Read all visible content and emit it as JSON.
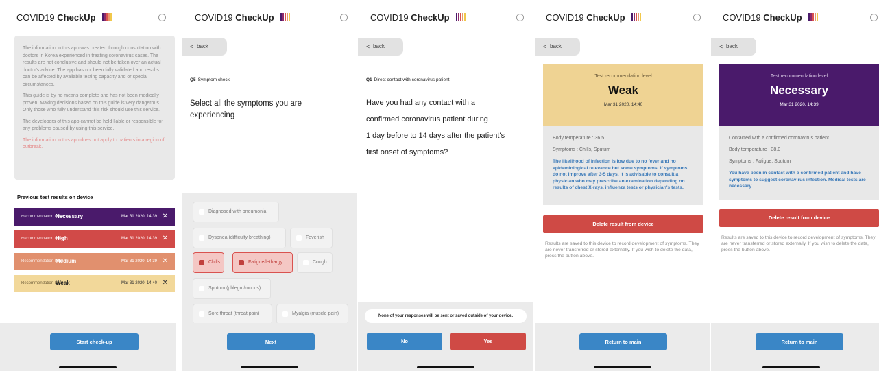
{
  "app": {
    "title_prefix": "COVID19",
    "title_bold": "CheckUp",
    "info_glyph": "i",
    "logo_colors": [
      "#4a1a6b",
      "#8e2a6a",
      "#d9524f",
      "#e89a6a",
      "#f1c84b"
    ],
    "back_label": "back",
    "back_glyph": "<"
  },
  "screen1": {
    "disclaimer": [
      "The information in this app was created through consultation with doctors in Korea experienced in treating coronavirus cases. The results are not conclusive and should not be taken over an actual doctor's advice. The app has not been fully validated and results can be affected by available testing capacity and or special circumstances.",
      "This guide is by no means complete and has not been medically proven. Making decisions based on this guide is very dangerous. Only those who fully understand this risk should use this service.",
      "The developers of this app cannot be held liable or responsible for any problems caused by using this service."
    ],
    "disclaimer_warning": "The information in this app does not apply to patients in a region of outbreak.",
    "prev_title": "Previous test results on device",
    "results": [
      {
        "label": "Recommendation level",
        "level": "Necessary",
        "date": "Mar 31 2020, 14:39",
        "color": "#4a1a6b",
        "close": "✕"
      },
      {
        "label": "Recommendation level",
        "level": "High",
        "date": "Mar 31 2020, 14:39",
        "color": "#d14a48",
        "close": "✕"
      },
      {
        "label": "Recommendation level",
        "level": "Medium",
        "date": "Mar 31 2020, 14:39",
        "color": "#e1906e",
        "close": "✕"
      },
      {
        "label": "Recommendation level",
        "level": "Weak",
        "date": "Mar 31 2020, 14:40",
        "color": "#f2d89a",
        "close": "✕"
      }
    ],
    "start_button": "Start check-up"
  },
  "screen2": {
    "q_num": "Q5",
    "q_title": "Symptom check",
    "question": "Select all the symptoms you are experiencing",
    "symptoms": [
      {
        "label": "Diagnosed with pneumonia",
        "selected": false
      },
      {
        "label": "Dyspnea (difficulty breathing)",
        "selected": false
      },
      {
        "label": "Feverish",
        "selected": false
      },
      {
        "label": "Chills",
        "selected": true
      },
      {
        "label": "Fatigue/lethargy",
        "selected": true
      },
      {
        "label": "Cough",
        "selected": false
      },
      {
        "label": "Sputum (phlegm/mucus)",
        "selected": false
      },
      {
        "label": "Sore throat (throat pain)",
        "selected": false
      },
      {
        "label": "Myalgia (muscle pain)",
        "selected": false
      }
    ],
    "next_button": "Next"
  },
  "screen3": {
    "q_num": "Q1",
    "q_title": "Direct contact with coronavirus patient",
    "question_lines": [
      "Have you had any contact with a",
      "confirmed coronavirus patient during",
      "1 day before to 14 days after the patient's",
      "first onset of symptoms?"
    ],
    "notice": "None of your responses will be sent or saved outside of your device.",
    "no_button": "No",
    "yes_button": "Yes"
  },
  "screen4": {
    "card_label": "Test recommendation level",
    "level": "Weak",
    "date": "Mar 31 2020, 14:40",
    "card_color": "#efd393",
    "details": [
      "Body temperature : 36.5",
      "Symptoms : Chills, Sputum"
    ],
    "highlight": "The likelihood of infection is low due to no fever and no epidemiological relevance but some symptoms. If symptoms do not improve after 3-5 days, it is advisable to consult a physician who may prescribe an examination depending on results of chest X-rays, influenza tests or physician's tests.",
    "delete_button": "Delete result from device",
    "save_note": "Results are saved to this device to record development of symptoms. They are never transferred or stored externally. If you wish to delete the data, press the button above.",
    "return_button": "Return to main"
  },
  "screen5": {
    "card_label": "Test recommendation level",
    "level": "Necessary",
    "date": "Mar 31 2020, 14:39",
    "card_color": "#4a1a6b",
    "details": [
      "Contacted with a confirmed coronavirus patient",
      "Body temperature : 38.0",
      "Symptoms : Fatigue, Sputum"
    ],
    "highlight": "You have been in contact with a confirmed patient and have symptoms to suggest coronavirus infection. Medical tests are necessary.",
    "delete_button": "Delete result from device",
    "save_note": "Results are saved to this device to record development of symptoms. They are never transferred or stored externally. If you wish to delete the data, press the button above.",
    "return_button": "Return to main"
  }
}
